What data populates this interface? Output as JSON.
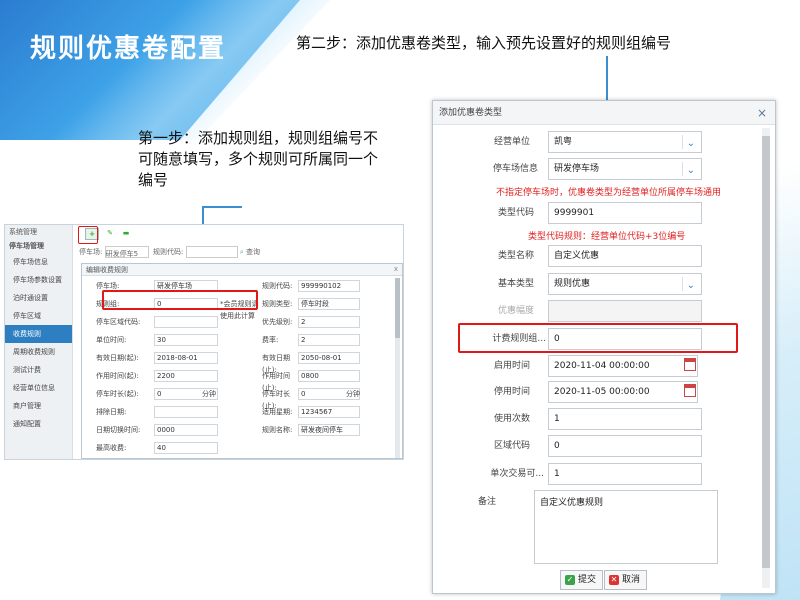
{
  "slide": {
    "title": "规则优惠卷配置",
    "step2": "第二步：添加优惠卷类型，输入预先设置好的规则组编号",
    "step1": "第一步：添加规则组，规则组编号不可随意填写，多个规则可所属同一个编号"
  },
  "left_window": {
    "sidebar_top": "系统管理",
    "sidebar_group": "停车场管理",
    "sidebar_items": [
      "停车场信息",
      "停车场参数设置",
      "泊时通设置",
      "停车区域",
      "收费规则",
      "周期收费规则",
      "测试计费",
      "经营单位信息",
      "商户管理",
      "通知配置"
    ],
    "filter": {
      "lot_label": "停车场:",
      "lot_value": "研发停车5",
      "code_label": "规则代码:",
      "search_label": "查询"
    },
    "dialog": {
      "title": "编辑收费规则",
      "close": "x",
      "rows": [
        {
          "label": "停车场:",
          "value": "研发停车场",
          "label2": "规则代码:",
          "value2": "999990102"
        },
        {
          "label": "规则组:",
          "value": "0",
          "hint": "*会员规则请使用此计算",
          "label2": "规则类型:",
          "value2": "停车时段"
        },
        {
          "label": "停车区域代码:",
          "value": "",
          "label2": "优先级别:",
          "value2": "2"
        },
        {
          "label": "单位时间:",
          "value": "30",
          "label2": "费率:",
          "value2": "2"
        },
        {
          "label": "有效日期(起):",
          "value": "2018-08-01",
          "label2": "有效日期(止):",
          "value2": "2050-08-01"
        },
        {
          "label": "作用时间(起):",
          "value": "2200",
          "label2": "作用时间(止):",
          "value2": "0800"
        },
        {
          "label": "停车时长(起):",
          "value": "0",
          "unit": "分钟",
          "label2": "停车时长(止):",
          "value2": "0",
          "unit2": "分钟"
        },
        {
          "label": "排除日期:",
          "value": "",
          "label2": "适用星期:",
          "value2": "1234567"
        },
        {
          "label": "日期切换时间:",
          "value": "0000",
          "label2": "规则名称:",
          "value2": "研发夜间停车"
        },
        {
          "label": "最高收费:",
          "value": "40"
        }
      ]
    }
  },
  "right_dialog": {
    "title": "添加优惠卷类型",
    "close": "×",
    "fields": {
      "operator": {
        "label": "经营单位",
        "value": "凯粤"
      },
      "lot": {
        "label": "停车场信息",
        "value": "研发停车场"
      },
      "lot_note": "不指定停车场时，优惠卷类型为经营单位所属停车场通用",
      "type_code": {
        "label": "类型代码",
        "value": "9999901"
      },
      "type_code_note": "类型代码规则：经营单位代码+3位编号",
      "type_name": {
        "label": "类型名称",
        "value": "自定义优惠"
      },
      "base_type": {
        "label": "基本类型",
        "value": "规则优惠"
      },
      "discount": {
        "label": "优惠幅度",
        "value": ""
      },
      "rule_group": {
        "label": "计费规则组...",
        "value": "0"
      },
      "start_time": {
        "label": "启用时间",
        "value": "2020-11-04 00:00:00"
      },
      "stop_time": {
        "label": "停用时间",
        "value": "2020-11-05 00:00:00"
      },
      "use_count": {
        "label": "使用次数",
        "value": "1"
      },
      "region_code": {
        "label": "区域代码",
        "value": "0"
      },
      "single_tx": {
        "label": "单次交易可...",
        "value": "1"
      },
      "remark": {
        "label": "备注",
        "value": "自定义优惠规则"
      }
    },
    "submit_label": "提交",
    "cancel_label": "取消"
  },
  "colors": {
    "accent": "#2e7fc1",
    "highlight": "#e01818",
    "note": "#e02020"
  }
}
